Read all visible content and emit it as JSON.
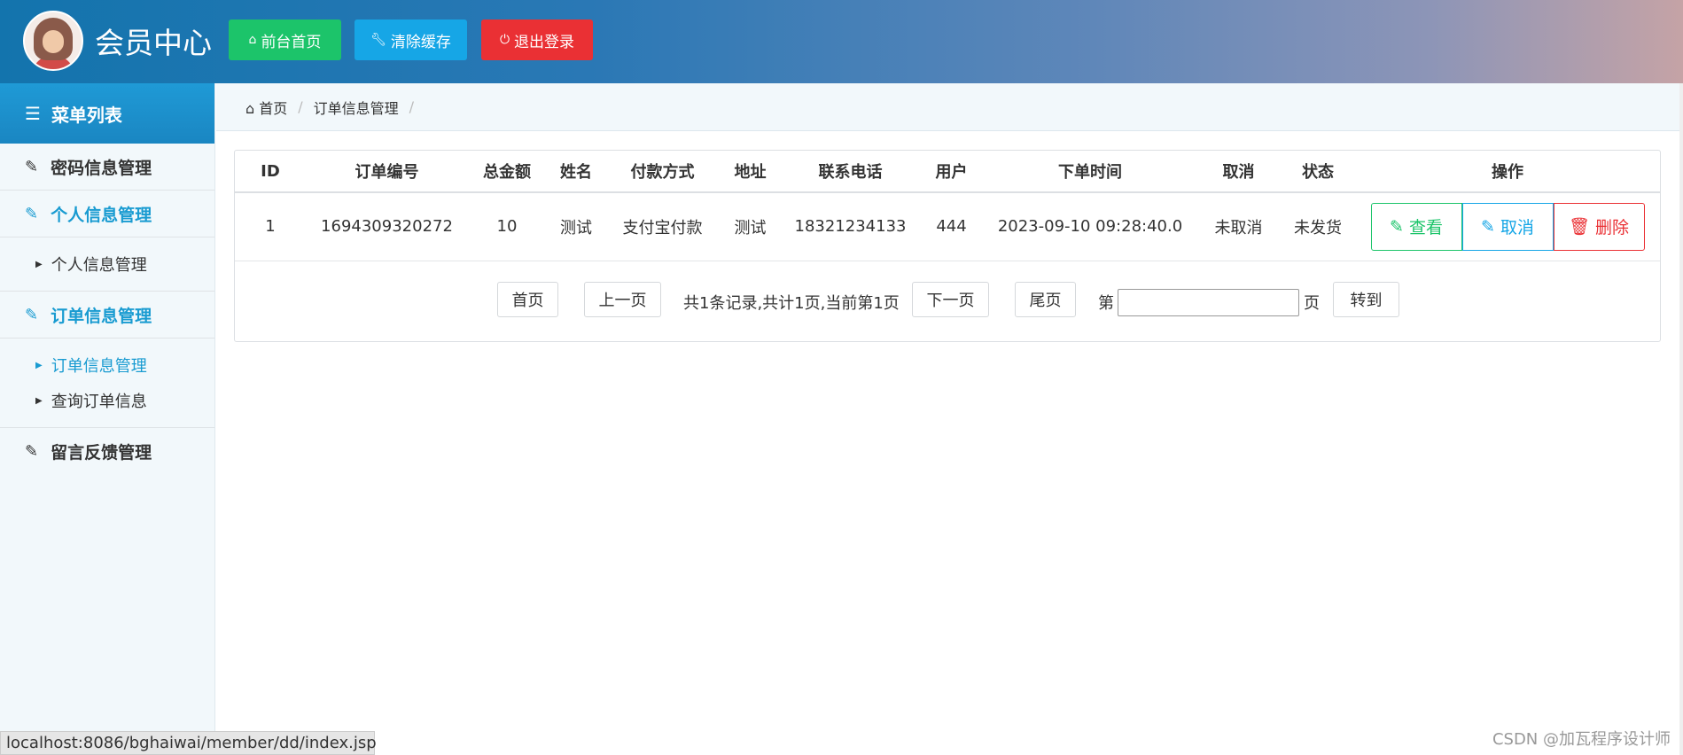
{
  "header": {
    "title": "会员中心",
    "buttons": {
      "home": "前台首页",
      "clear_cache": "清除缓存",
      "logout": "退出登录"
    }
  },
  "sidebar": {
    "heading": "菜单列表",
    "sections": [
      {
        "label": "密码信息管理"
      },
      {
        "label": "个人信息管理",
        "items": [
          "个人信息管理"
        ]
      },
      {
        "label": "订单信息管理",
        "items": [
          "订单信息管理",
          "查询订单信息"
        ]
      },
      {
        "label": "留言反馈管理"
      }
    ]
  },
  "breadcrumb": {
    "home": "首页",
    "current": "订单信息管理"
  },
  "table": {
    "columns": [
      "ID",
      "订单编号",
      "总金额",
      "姓名",
      "付款方式",
      "地址",
      "联系电话",
      "用户",
      "下单时间",
      "取消",
      "状态",
      "操作"
    ],
    "rows": [
      [
        "1",
        "1694309320272",
        "10",
        "测试",
        "支付宝付款",
        "测试",
        "18321234133",
        "444",
        "2023-09-10 09:28:40.0",
        "未取消",
        "未发货"
      ]
    ],
    "actions": {
      "view": "查看",
      "cancel": "取消",
      "delete": "删除"
    }
  },
  "pager": {
    "first": "首页",
    "prev": "上一页",
    "summary": "共1条记录,共计1页,当前第1页",
    "next": "下一页",
    "last": "尾页",
    "page_prefix": "第",
    "page_suffix": "页",
    "goto": "转到",
    "page_input_value": ""
  },
  "status_bar": {
    "url": "localhost:8086/bghaiwai/member/dd/index.jsp"
  },
  "watermark": "CSDN @加瓦程序设计师",
  "colors": {
    "green": "#1cc46a",
    "blue": "#16a6e6",
    "red": "#ea3034",
    "accent": "#199bd1"
  }
}
